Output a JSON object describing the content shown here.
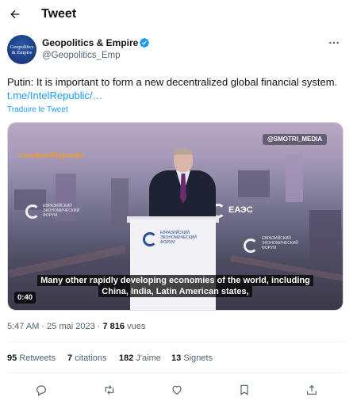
{
  "header": {
    "title": "Tweet"
  },
  "author": {
    "name": "Geopolitics & Empire",
    "handle": "@Geopolitics_Emp",
    "avatar_text": [
      "Geopolitics",
      "& Empire"
    ]
  },
  "tweet": {
    "text": "Putin: It is important to form a new decentralized global financial system.",
    "link": "t.me/IntelRepublic/…",
    "translate_label": "Traduire le Tweet"
  },
  "media": {
    "watermark_top": "@SMOTRI_MEDIA",
    "watermark_left": "t.me/IntelRepublic",
    "duration": "0:40",
    "subtitle_line1": "Many other rapidly developing economies of the world, including",
    "subtitle_line2": "China, India, Latin American states,",
    "eaes_label": "ЕАЭС",
    "forum_lines": [
      "ЕВРАЗИЙСКИЙ",
      "ЭКОНОМИЧЕСКИЙ",
      "ФОРУМ"
    ]
  },
  "meta": {
    "time": "5:47 AM",
    "separator": "·",
    "date": "25 mai 2023",
    "views": "7 816",
    "views_label": "vues"
  },
  "stats": {
    "retweets": "95",
    "retweets_label": "Retweets",
    "quotes": "7",
    "quotes_label": "citations",
    "likes": "182",
    "likes_label": "J'aime",
    "bookmarks": "13",
    "bookmarks_label": "Signets"
  },
  "colors": {
    "accent": "#1d9bf0",
    "text": "#0f1419",
    "secondary": "#536471",
    "verified": "#1d9bf0"
  },
  "icons": [
    "back-arrow-icon",
    "verified-badge-icon",
    "more-icon",
    "reply-icon",
    "retweet-icon",
    "like-icon",
    "bookmark-icon",
    "share-icon"
  ]
}
